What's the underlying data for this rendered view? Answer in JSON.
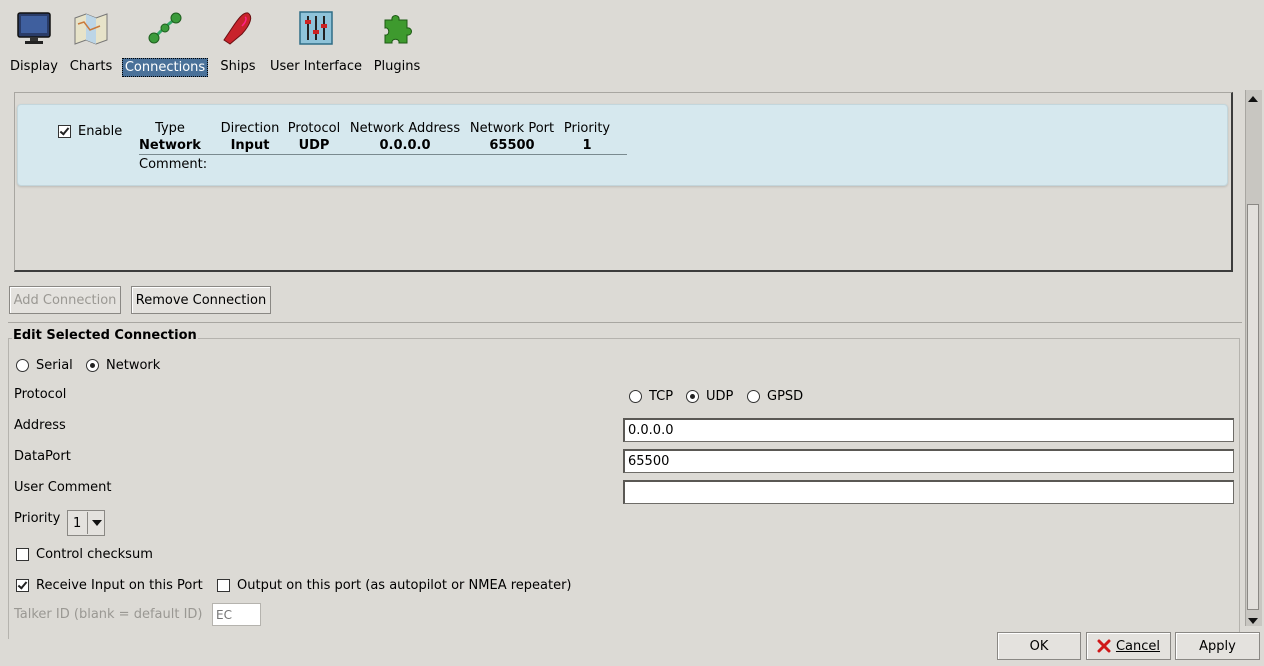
{
  "toolbar": {
    "items": [
      {
        "label": "Display",
        "icon": "monitor-icon",
        "selected": false
      },
      {
        "label": "Charts",
        "icon": "charts-icon",
        "selected": false
      },
      {
        "label": "Connections",
        "icon": "connections-icon",
        "selected": true
      },
      {
        "label": "Ships",
        "icon": "ship-icon",
        "selected": false
      },
      {
        "label": "User Interface",
        "icon": "sliders-icon",
        "selected": false
      },
      {
        "label": "Plugins",
        "icon": "puzzle-icon",
        "selected": false
      }
    ]
  },
  "connection_list": {
    "enable_label": "Enable",
    "enabled": true,
    "columns": [
      "Type",
      "Direction",
      "Protocol",
      "Network Address",
      "Network Port",
      "Priority"
    ],
    "values": [
      "Network",
      "Input",
      "UDP",
      "0.0.0.0",
      "65500",
      "1"
    ],
    "comment_label": "Comment:",
    "comment": ""
  },
  "list_buttons": {
    "add": "Add Connection",
    "remove": "Remove Connection"
  },
  "edit": {
    "title": "Edit Selected Connection",
    "type_options": {
      "serial": "Serial",
      "network": "Network",
      "selected": "Network"
    },
    "protocol_label": "Protocol",
    "protocol_options": {
      "tcp": "TCP",
      "udp": "UDP",
      "gpsd": "GPSD",
      "selected": "UDP"
    },
    "address_label": "Address",
    "address_value": "0.0.0.0",
    "dataport_label": "DataPort",
    "dataport_value": "65500",
    "comment_label": "User Comment",
    "comment_value": "",
    "priority_label": "Priority",
    "priority_value": "1",
    "control_checksum_label": "Control checksum",
    "control_checksum": false,
    "receive_input_label": "Receive Input on this Port",
    "receive_input": true,
    "output_label": "Output on this port (as autopilot or NMEA repeater)",
    "output": false,
    "talker_label": "Talker ID (blank = default ID)",
    "talker_placeholder": "EC"
  },
  "dialog_buttons": {
    "ok": "OK",
    "cancel": "Cancel",
    "apply": "Apply"
  },
  "colors": {
    "selection": "#4a7199",
    "card": "#d6e8ee",
    "window": "#dcdad5"
  }
}
